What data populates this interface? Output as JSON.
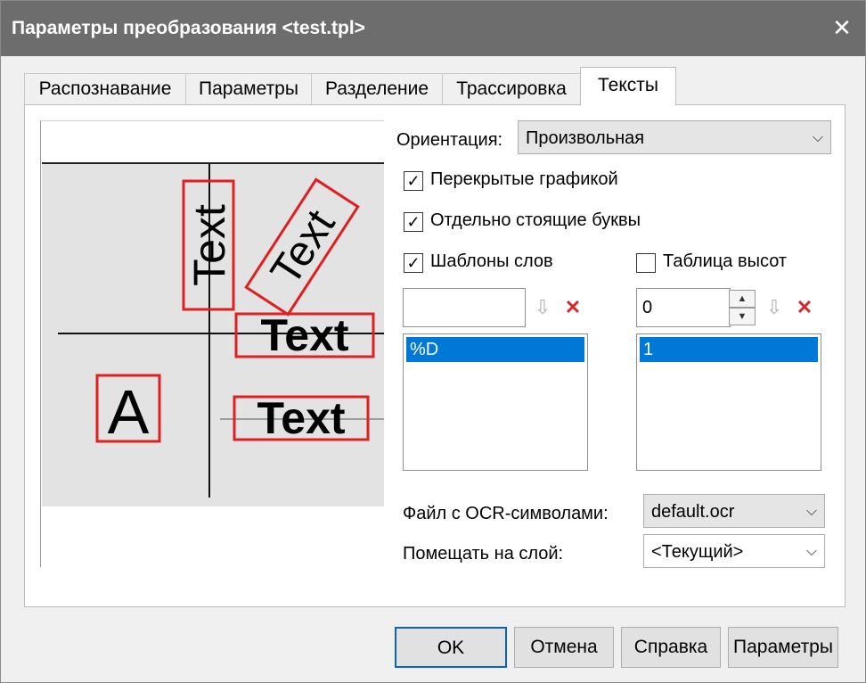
{
  "window": {
    "title": "Параметры преобразования <test.tpl>",
    "close_glyph": "✕"
  },
  "tabs": [
    {
      "label": "Распознавание",
      "active": false
    },
    {
      "label": "Параметры",
      "active": false
    },
    {
      "label": "Разделение",
      "active": false
    },
    {
      "label": "Трассировка",
      "active": false
    },
    {
      "label": "Тексты",
      "active": true
    }
  ],
  "preview": {
    "samples": [
      "Text",
      "Text",
      "Text",
      "Text",
      "A"
    ]
  },
  "orientation": {
    "label": "Ориентация:",
    "value": "Произвольная"
  },
  "checkboxes": {
    "overlapped": {
      "label": "Перекрытые графикой",
      "checked": true
    },
    "separate_letters": {
      "label": "Отдельно стоящие буквы",
      "checked": true
    },
    "word_templates": {
      "label": "Шаблоны слов",
      "checked": true
    },
    "height_table": {
      "label": "Таблица высот",
      "checked": false
    }
  },
  "word_templates": {
    "input_value": "",
    "items": [
      "%D"
    ]
  },
  "height_table": {
    "input_value": "0",
    "items": [
      "1"
    ]
  },
  "ocr_file": {
    "label": "Файл с OCR-символами:",
    "value": "default.ocr"
  },
  "layer": {
    "label": "Помещать на слой:",
    "value": "<Текущий>"
  },
  "buttons": {
    "ok": "OK",
    "cancel": "Отмена",
    "help": "Справка",
    "params": "Параметры"
  },
  "icons": {
    "check": "✓",
    "chevron": "⌵",
    "down_arrow": "⇩",
    "delete": "✕",
    "spin_up": "▲",
    "spin_down": "▼"
  },
  "colors": {
    "titlebar": "#6d6d6d",
    "selection": "#0078d7",
    "sample_border": "#e02020",
    "delete_icon": "#d22a2a"
  }
}
